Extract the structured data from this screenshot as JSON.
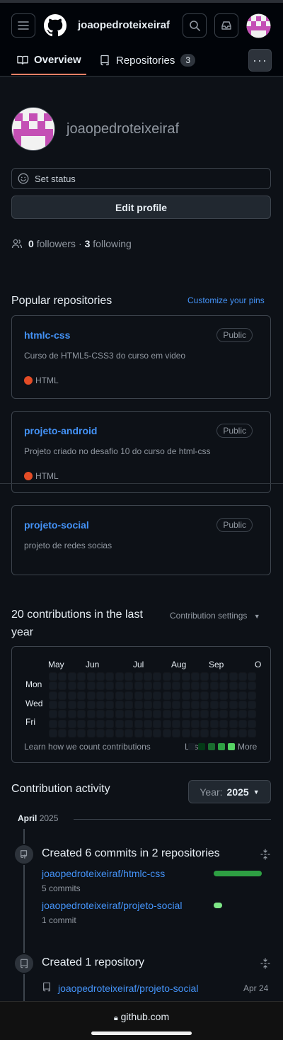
{
  "header": {
    "username": "joaopedroteixeiraf",
    "menu_icon": "hamburger-icon",
    "logo_icon": "github-logo-icon",
    "search_icon": "search-icon",
    "inbox_icon": "inbox-icon"
  },
  "tabs": [
    {
      "label": "Overview",
      "icon": "book-icon",
      "active": true
    },
    {
      "label": "Repositories",
      "icon": "repo-icon",
      "count": "3"
    }
  ],
  "profile": {
    "username": "joaopedroteixeiraf",
    "set_status": "Set status",
    "edit_profile": "Edit profile",
    "followers_count": "0",
    "followers_label": "followers",
    "separator": "·",
    "following_count": "3",
    "following_label": "following"
  },
  "popular": {
    "title": "Popular repositories",
    "customize": "Customize your pins",
    "repos": [
      {
        "name": "htmlc-css",
        "visibility": "Public",
        "description": "Curso de HTML5-CSS3 do curso em video",
        "language": "HTML"
      },
      {
        "name": "projeto-android",
        "visibility": "Public",
        "description": "Projeto criado no desafio 10 do curso de html-css",
        "language": "HTML"
      },
      {
        "name": "projeto-social",
        "visibility": "Public",
        "description": "projeto de redes socias"
      }
    ]
  },
  "contributions": {
    "title": "20 contributions in the last year",
    "settings": "Contribution settings",
    "months": [
      "May",
      "Jun",
      "Jul",
      "Aug",
      "Sep",
      "O"
    ],
    "days": [
      "Mon",
      "Wed",
      "Fri"
    ],
    "learn": "Learn how we count contributions",
    "less": "Less",
    "more": "More",
    "colors": {
      "empty": "#151b23",
      "l1": "#033a16",
      "l2": "#196c2e",
      "l3": "#2ea043",
      "l4": "#56d364"
    }
  },
  "activity": {
    "title": "Contribution activity",
    "year_label": "Year:",
    "year_value": "2025",
    "month": "April",
    "month_year": "2025",
    "commits_title": "Created 6 commits in 2 repositories",
    "commit_repos": [
      {
        "name": "joaopedroteixeiraf/htmlc-css",
        "count": "5 commits",
        "fraction": 0.83
      },
      {
        "name": "joaopedroteixeiraf/projeto-social",
        "count": "1 commit",
        "fraction": 0.17
      }
    ],
    "created_title": "Created 1 repository",
    "created_repo": "joaopedroteixeiraf/projeto-social",
    "created_date": "Apr 24"
  },
  "browser": {
    "url": "github.com"
  }
}
